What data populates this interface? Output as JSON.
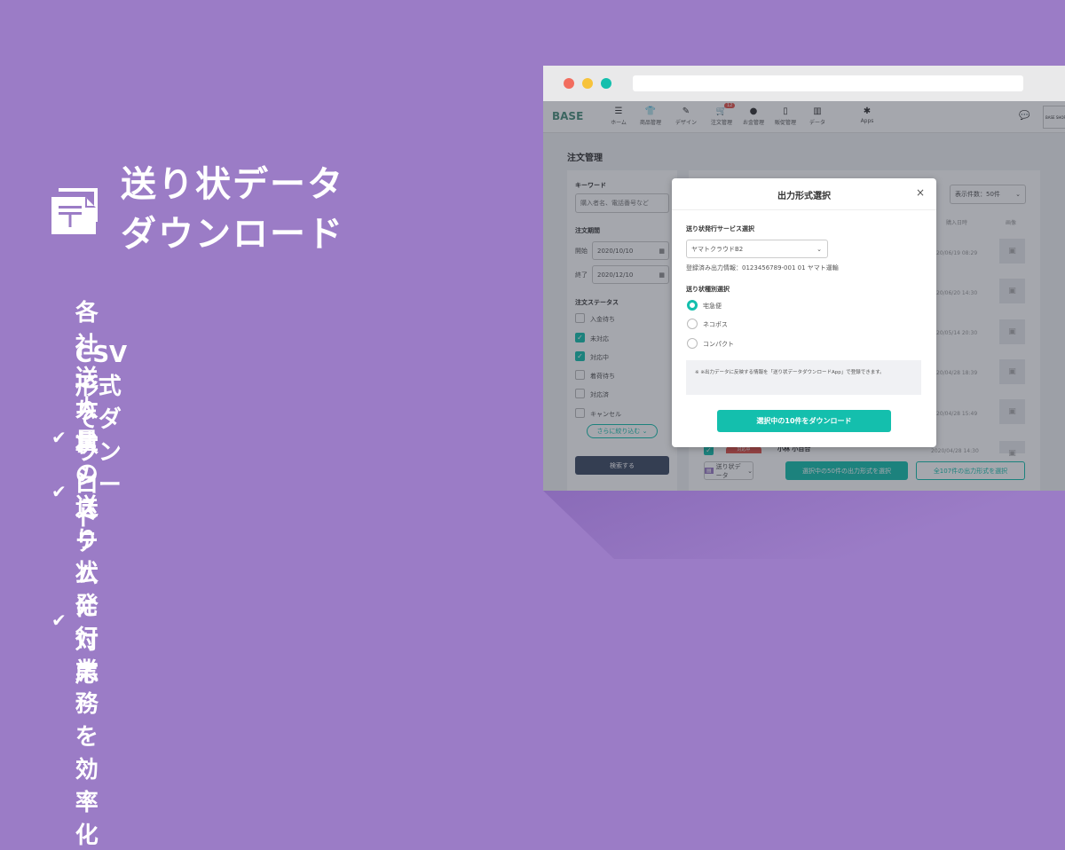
{
  "hero": {
    "title": "送り状データ\nダウンロード",
    "icon": "mail-postal-document-icon",
    "features": [
      "各社送り状システムに対応",
      "CSV形式でダウンロード",
      "大量の送り状発行業務を効率化"
    ]
  },
  "colors": {
    "background": "#9b7cc6",
    "accent": "#14bfad",
    "dark_button": "#3d4a63",
    "badge": "#e3544b"
  },
  "app": {
    "logo": "BASE",
    "nav": [
      {
        "label": "ホーム",
        "icon": "menu-icon"
      },
      {
        "label": "商品管理",
        "icon": "shirt-icon"
      },
      {
        "label": "デザイン",
        "icon": "brush-icon"
      },
      {
        "label": "注文管理",
        "icon": "cart-icon",
        "badge": "12"
      },
      {
        "label": "お金管理",
        "icon": "money-bag-icon"
      },
      {
        "label": "販促管理",
        "icon": "phone-icon"
      },
      {
        "label": "データ",
        "icon": "bar-chart-icon"
      },
      {
        "label": "Apps",
        "icon": "puzzle-icon"
      }
    ],
    "shop_label": "BASE SHOP",
    "page_title": "注文管理",
    "sidebar": {
      "keyword_label": "キーワード",
      "keyword_placeholder": "購入者名、電話番号など",
      "period_label": "注文期間",
      "start_label": "開始",
      "start_value": "2020/10/10",
      "end_label": "終了",
      "end_value": "2020/12/10",
      "status_label": "注文ステータス",
      "statuses": [
        {
          "label": "入金待ち",
          "checked": false
        },
        {
          "label": "未対応",
          "checked": true
        },
        {
          "label": "対応中",
          "checked": true
        },
        {
          "label": "着荷待ち",
          "checked": false
        },
        {
          "label": "対応済",
          "checked": false
        },
        {
          "label": "キャンセル",
          "checked": false
        }
      ],
      "more_filter": "さらに絞り込む",
      "search_button": "検索する"
    },
    "main": {
      "per_page": "表示件数：50件",
      "headers": {
        "date": "購入日時",
        "image": "画像"
      },
      "rows": [
        {
          "date": "20/06/19 08:29"
        },
        {
          "date": "20/06/20 14:30"
        },
        {
          "date": "20/05/14 20:30"
        },
        {
          "date": "20/04/28 18:39"
        },
        {
          "date": "20/04/28 15:49"
        },
        {
          "date": "2020/04/28 14:30",
          "name": "小林 小百合",
          "status": "対応中"
        }
      ],
      "export_dropdown": "送り状データ",
      "select_page_button": "選択中の50件の出力形式を選択",
      "select_all_button": "全107件の出力形式を選択"
    }
  },
  "modal": {
    "title": "出力形式選択",
    "service_label": "送り状発行サービス選択",
    "service_value": "ヤマトクラウドB2",
    "registered_info": "登録済み出力情報：0123456789-001 01 ヤマト運輸",
    "type_label": "送り状種別選択",
    "types": [
      {
        "label": "宅急便",
        "selected": true
      },
      {
        "label": "ネコポス",
        "selected": false
      },
      {
        "label": "コンパクト",
        "selected": false
      }
    ],
    "note": "※ ※出力データに反映する情報を「送り状データダウンロードApp」で登録できます。",
    "download_button": "選択中の10件をダウンロード"
  }
}
